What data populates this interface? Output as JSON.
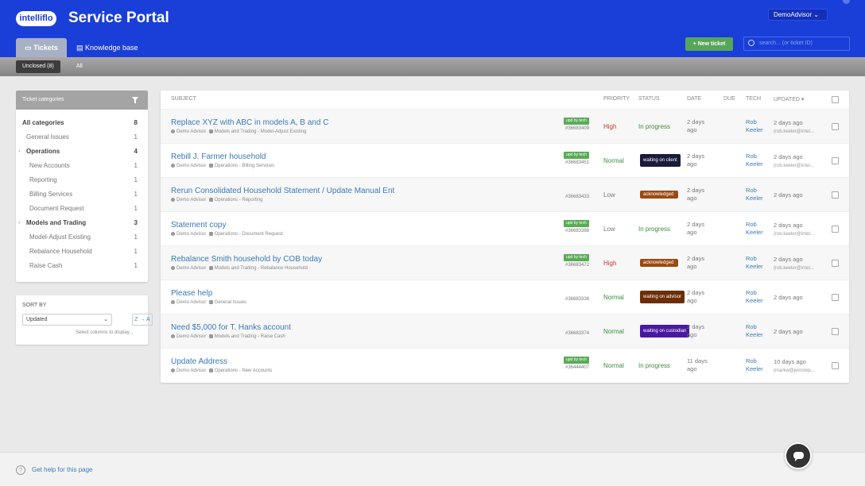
{
  "header": {
    "logo": "intelliflo",
    "title": "Service Portal",
    "user": "DemoAdvisor ⌄"
  },
  "tabs": {
    "tickets": "Tickets",
    "kb": "Knowledge base"
  },
  "actions": {
    "new_ticket": "+ New ticket",
    "search_placeholder": "search... (or ticket ID)"
  },
  "filters": {
    "unclosed": "Unclosed (8)",
    "all": "All"
  },
  "categories": {
    "header": "Ticket categories",
    "items": [
      {
        "label": "All categories",
        "count": "8"
      },
      {
        "label": "General Issues",
        "count": "1"
      },
      {
        "label": "Operations",
        "count": "4"
      },
      {
        "label": "New Accounts",
        "count": "1"
      },
      {
        "label": "Reporting",
        "count": "1"
      },
      {
        "label": "Billing Services",
        "count": "1"
      },
      {
        "label": "Document Request",
        "count": "1"
      },
      {
        "label": "Models and Trading",
        "count": "3"
      },
      {
        "label": "Model-Adjust Existing",
        "count": "1"
      },
      {
        "label": "Rebalance Household",
        "count": "1"
      },
      {
        "label": "Raise Cash",
        "count": "1"
      }
    ]
  },
  "sort": {
    "label": "SORT BY",
    "value": "Updated",
    "direction": "Z → A",
    "help": "Select columns to display..."
  },
  "table": {
    "headers": {
      "subject": "SUBJECT",
      "priority": "PRIORITY",
      "status": "STATUS",
      "date": "DATE",
      "due": "DUE",
      "tech": "TECH",
      "updated": "UPDATED ▾"
    },
    "rows": [
      {
        "subject": "Replace XYZ with ABC in models A, B and C",
        "author": "Demo Advisor",
        "category": "Models and Trading - Model-Adjust Existing",
        "upd": "upd by tech",
        "id": "#36683409",
        "priority": "High",
        "status": "In progress",
        "date1": "2 days",
        "date2": "ago",
        "tech1": "Rob",
        "tech2": "Keeler",
        "updated1": "2 days ago",
        "updated2": "(rob.keeler@intel..."
      },
      {
        "subject": "Rebill J. Farmer household",
        "author": "Demo Advisor",
        "category": "Operations - Billing Services",
        "upd": "upd by tech",
        "id": "#36683451",
        "priority": "Normal",
        "status": "waiting on client",
        "date1": "2 days",
        "date2": "ago",
        "tech1": "Rob",
        "tech2": "Keeler",
        "updated1": "2 days ago",
        "updated2": "(rob.keeler@intel..."
      },
      {
        "subject": "Rerun Consolidated Household Statement / Update Manual Ent",
        "author": "Demo Advisor",
        "category": "Operations - Reporting",
        "upd": "",
        "id": "#36683433",
        "priority": "Low",
        "status": "acknowledged",
        "date1": "2 days",
        "date2": "ago",
        "tech1": "Rob",
        "tech2": "Keeler",
        "updated1": "2 days ago",
        "updated2": ""
      },
      {
        "subject": "Statement copy",
        "author": "Demo Advisor",
        "category": "Operations - Document Request",
        "upd": "upd by tech",
        "id": "#36683388",
        "priority": "Low",
        "status": "In progress",
        "date1": "2 days",
        "date2": "ago",
        "tech1": "Rob",
        "tech2": "Keeler",
        "updated1": "2 days ago",
        "updated2": "(rob.keeler@intel..."
      },
      {
        "subject": "Rebalance Smith household by COB today",
        "author": "Demo Advisor",
        "category": "Models and Trading - Rebalance Household",
        "upd": "upd by tech",
        "id": "#36683472",
        "priority": "High",
        "status": "acknowledged",
        "date1": "2 days",
        "date2": "ago",
        "tech1": "Rob",
        "tech2": "Keeler",
        "updated1": "2 days ago",
        "updated2": "(rob.keeler@intel..."
      },
      {
        "subject": "Please help",
        "author": "Demo Advisor",
        "category": "General Issues",
        "upd": "",
        "id": "#36683336",
        "priority": "Normal",
        "status": "waiting on advisor",
        "date1": "2 days",
        "date2": "ago",
        "tech1": "Rob",
        "tech2": "Keeler",
        "updated1": "2 days ago",
        "updated2": ""
      },
      {
        "subject": "Need $5,000 for T. Hanks account",
        "author": "Demo Advisor",
        "category": "Models and Trading - Raise Cash",
        "upd": "",
        "id": "#36683374",
        "priority": "Normal",
        "status": "waiting on custodian",
        "date1": "2 days",
        "date2": "ago",
        "tech1": "Rob",
        "tech2": "Keeler",
        "updated1": "2 days ago",
        "updated2": ""
      },
      {
        "subject": "Update Address",
        "author": "Demo Advisor",
        "category": "Operations - New Accounts",
        "upd": "upd by tech",
        "id": "#36444407",
        "priority": "Normal",
        "status": "In progress",
        "date1": "11 days",
        "date2": "ago",
        "tech1": "Rob",
        "tech2": "Keeler",
        "updated1": "10 days ago",
        "updated2": "(markw@jemstep..."
      }
    ]
  },
  "footer": {
    "help": "Get help for this page"
  },
  "colors": {
    "brand": "#1a3ed8",
    "high": "#c0392b",
    "normal": "#3c8c3c",
    "in_progress": "#3c8c3c",
    "ack": "#9a4a12",
    "waiting_client": "#1a1a3a",
    "waiting_advisor": "#6b2e08",
    "waiting_custodian": "#4a18a0"
  }
}
